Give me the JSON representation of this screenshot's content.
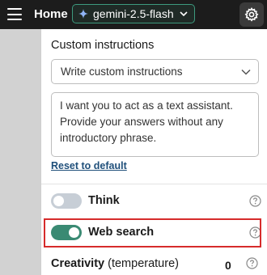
{
  "header": {
    "title": "Home",
    "model_selector": {
      "value": "gemini-2.5-flash",
      "icon": "sparkle-icon",
      "accent": "#3d9a7e"
    },
    "menu_icon": "hamburger-icon",
    "settings_icon": "gear-icon"
  },
  "panel": {
    "section_title": "Custom instructions",
    "instructions_select": {
      "value": "Write custom instructions"
    },
    "instructions_text": "I want you to act as a text assistant. Provide your answers without any introductory phrase.",
    "reset_link": "Reset to default",
    "toggles": [
      {
        "label": "Think",
        "on": false
      },
      {
        "label": "Web search",
        "on": true
      }
    ],
    "creativity": {
      "label": "Creativity",
      "suffix": "(temperature)",
      "value": "0"
    }
  },
  "colors": {
    "toggle_on": "#3a8a73",
    "toggle_off": "#c7ced6",
    "highlight": "#d62b2b"
  }
}
